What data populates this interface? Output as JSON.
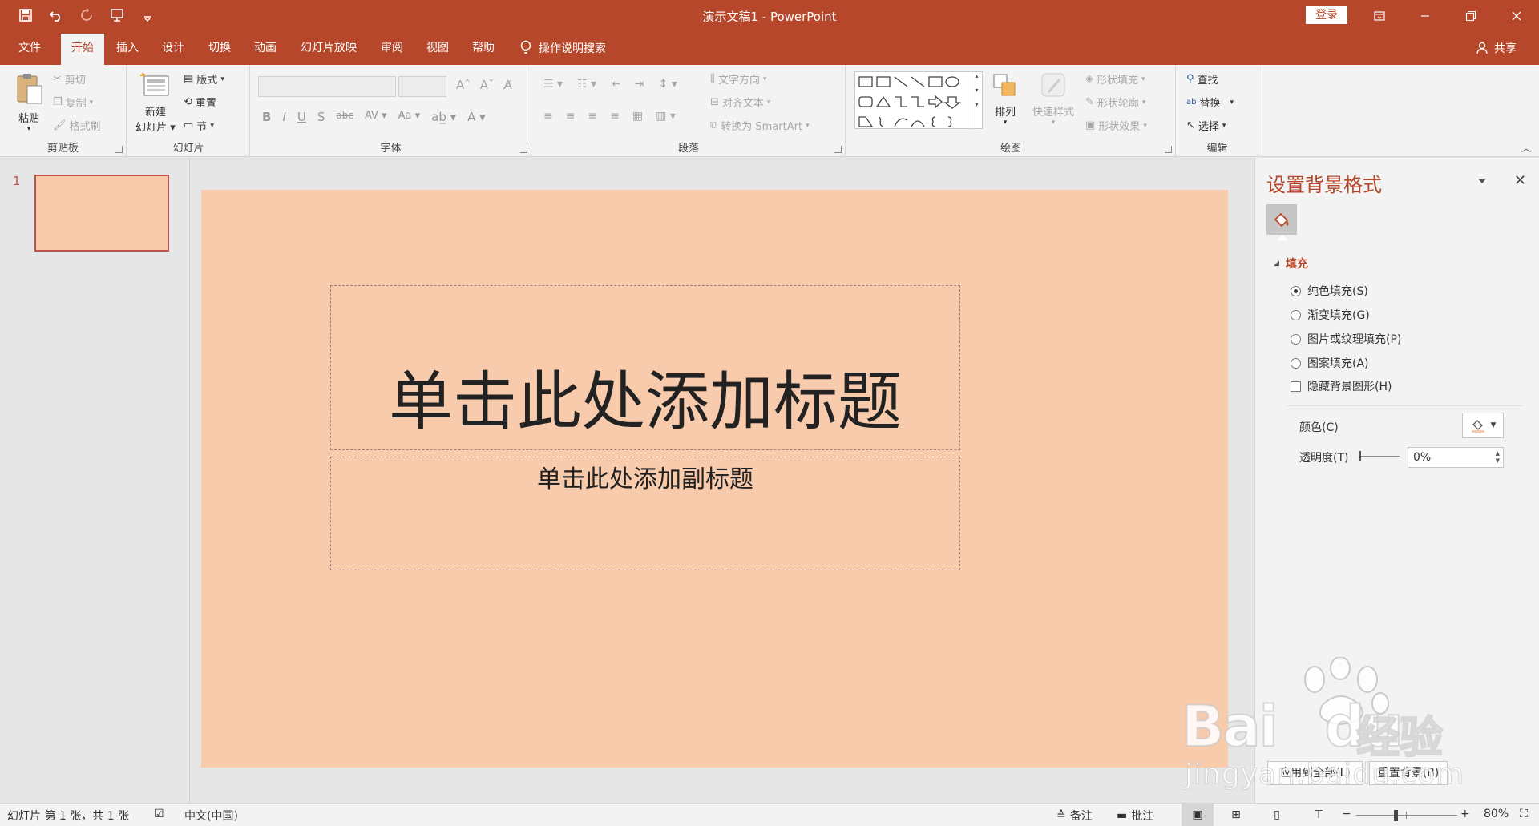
{
  "title_bar": {
    "doc_title": "演示文稿1  -  PowerPoint",
    "login": "登录"
  },
  "tabs": [
    {
      "label": "文件"
    },
    {
      "label": "开始"
    },
    {
      "label": "插入"
    },
    {
      "label": "设计"
    },
    {
      "label": "切换"
    },
    {
      "label": "动画"
    },
    {
      "label": "幻灯片放映"
    },
    {
      "label": "审阅"
    },
    {
      "label": "视图"
    },
    {
      "label": "帮助"
    }
  ],
  "tell_me": "操作说明搜索",
  "share": "共享",
  "ribbon": {
    "clipboard": {
      "label": "剪贴板",
      "paste": "粘贴",
      "cut": "剪切",
      "copy": "复制",
      "format_painter": "格式刷"
    },
    "slides": {
      "label": "幻灯片",
      "new_slide_1": "新建",
      "new_slide_2": "幻灯片",
      "layout": "版式",
      "reset": "重置",
      "section": "节"
    },
    "font": {
      "label": "字体"
    },
    "paragraph": {
      "label": "段落",
      "text_direction": "文字方向",
      "align_text": "对齐文本",
      "smartart": "转换为 SmartArt"
    },
    "drawing": {
      "label": "绘图",
      "arrange": "排列",
      "quick_styles": "快速样式",
      "shape_fill": "形状填充",
      "shape_outline": "形状轮廓",
      "shape_effects": "形状效果"
    },
    "editing": {
      "label": "编辑",
      "find": "查找",
      "replace": "替换",
      "select": "选择"
    }
  },
  "thumbnails": [
    {
      "number": "1",
      "color": "#f8cbad"
    }
  ],
  "slide": {
    "background": "#f8cbad",
    "title_placeholder": "单击此处添加标题",
    "subtitle_placeholder": "单击此处添加副标题"
  },
  "format_pane": {
    "title": "设置背景格式",
    "section": "填充",
    "options": [
      {
        "label": "纯色填充(S)",
        "checked": true
      },
      {
        "label": "渐变填充(G)",
        "checked": false
      },
      {
        "label": "图片或纹理填充(P)",
        "checked": false
      },
      {
        "label": "图案填充(A)",
        "checked": false
      }
    ],
    "hide_bg_graphics": "隐藏背景图形(H)",
    "color_label": "颜色(C)",
    "transparency_label": "透明度(T)",
    "transparency_value": "0%",
    "apply_all": "应用到全部(L)",
    "reset_bg": "重置背景(B)"
  },
  "watermark": {
    "brand": "Bai",
    "brand2": "du",
    "cn": "经验",
    "domain": "jingyan.baidu.com"
  },
  "status_bar": {
    "slide_info": "幻灯片 第 1 张，共 1 张",
    "language": "中文(中国)",
    "notes": "备注",
    "comments": "批注",
    "zoom": "80%"
  },
  "colors": {
    "accent": "#b7472a",
    "slide_bg": "#f8cbad"
  }
}
